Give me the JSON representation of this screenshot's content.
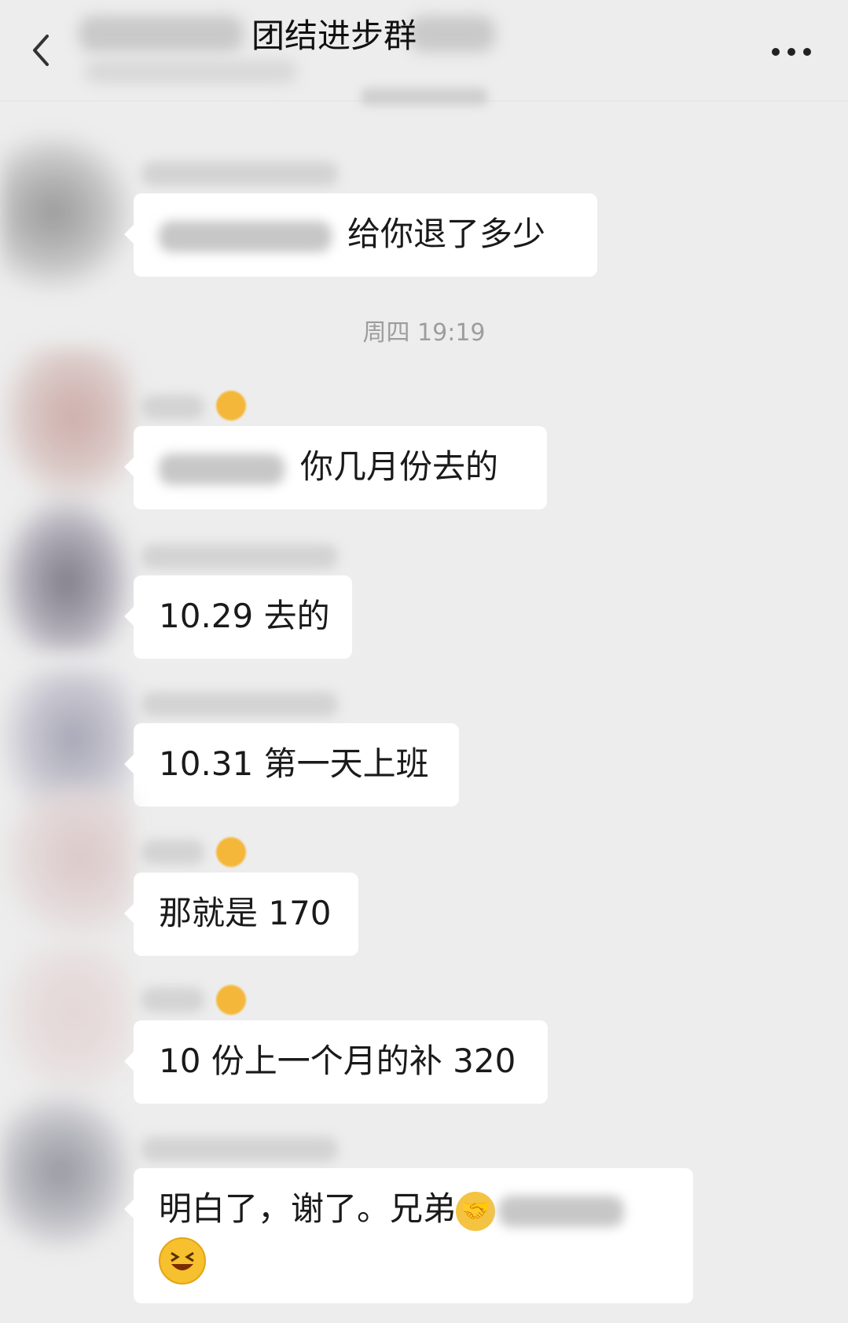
{
  "header": {
    "title": "团结进步群",
    "back_icon": "chevron-left-icon",
    "more_icon": "more-horizontal-icon"
  },
  "timestamps": {
    "second": "周四 19:19"
  },
  "messages": [
    {
      "text": "给你退了多少",
      "has_mention": true
    },
    {
      "text": "你几月份去的",
      "has_mention": true
    },
    {
      "text": "10.29 去的"
    },
    {
      "text": "10.31 第一天上班"
    },
    {
      "text": "那就是 170"
    },
    {
      "text": "10 份上一个月的补 320"
    },
    {
      "text": "明白了，谢了。兄弟",
      "icons": [
        "handshake-icon",
        "grinning-squint-emoji"
      ],
      "has_mention": true
    }
  ],
  "colors": {
    "background": "#ededed",
    "bubble": "#ffffff",
    "timestamp_text": "#9d9d9d"
  }
}
